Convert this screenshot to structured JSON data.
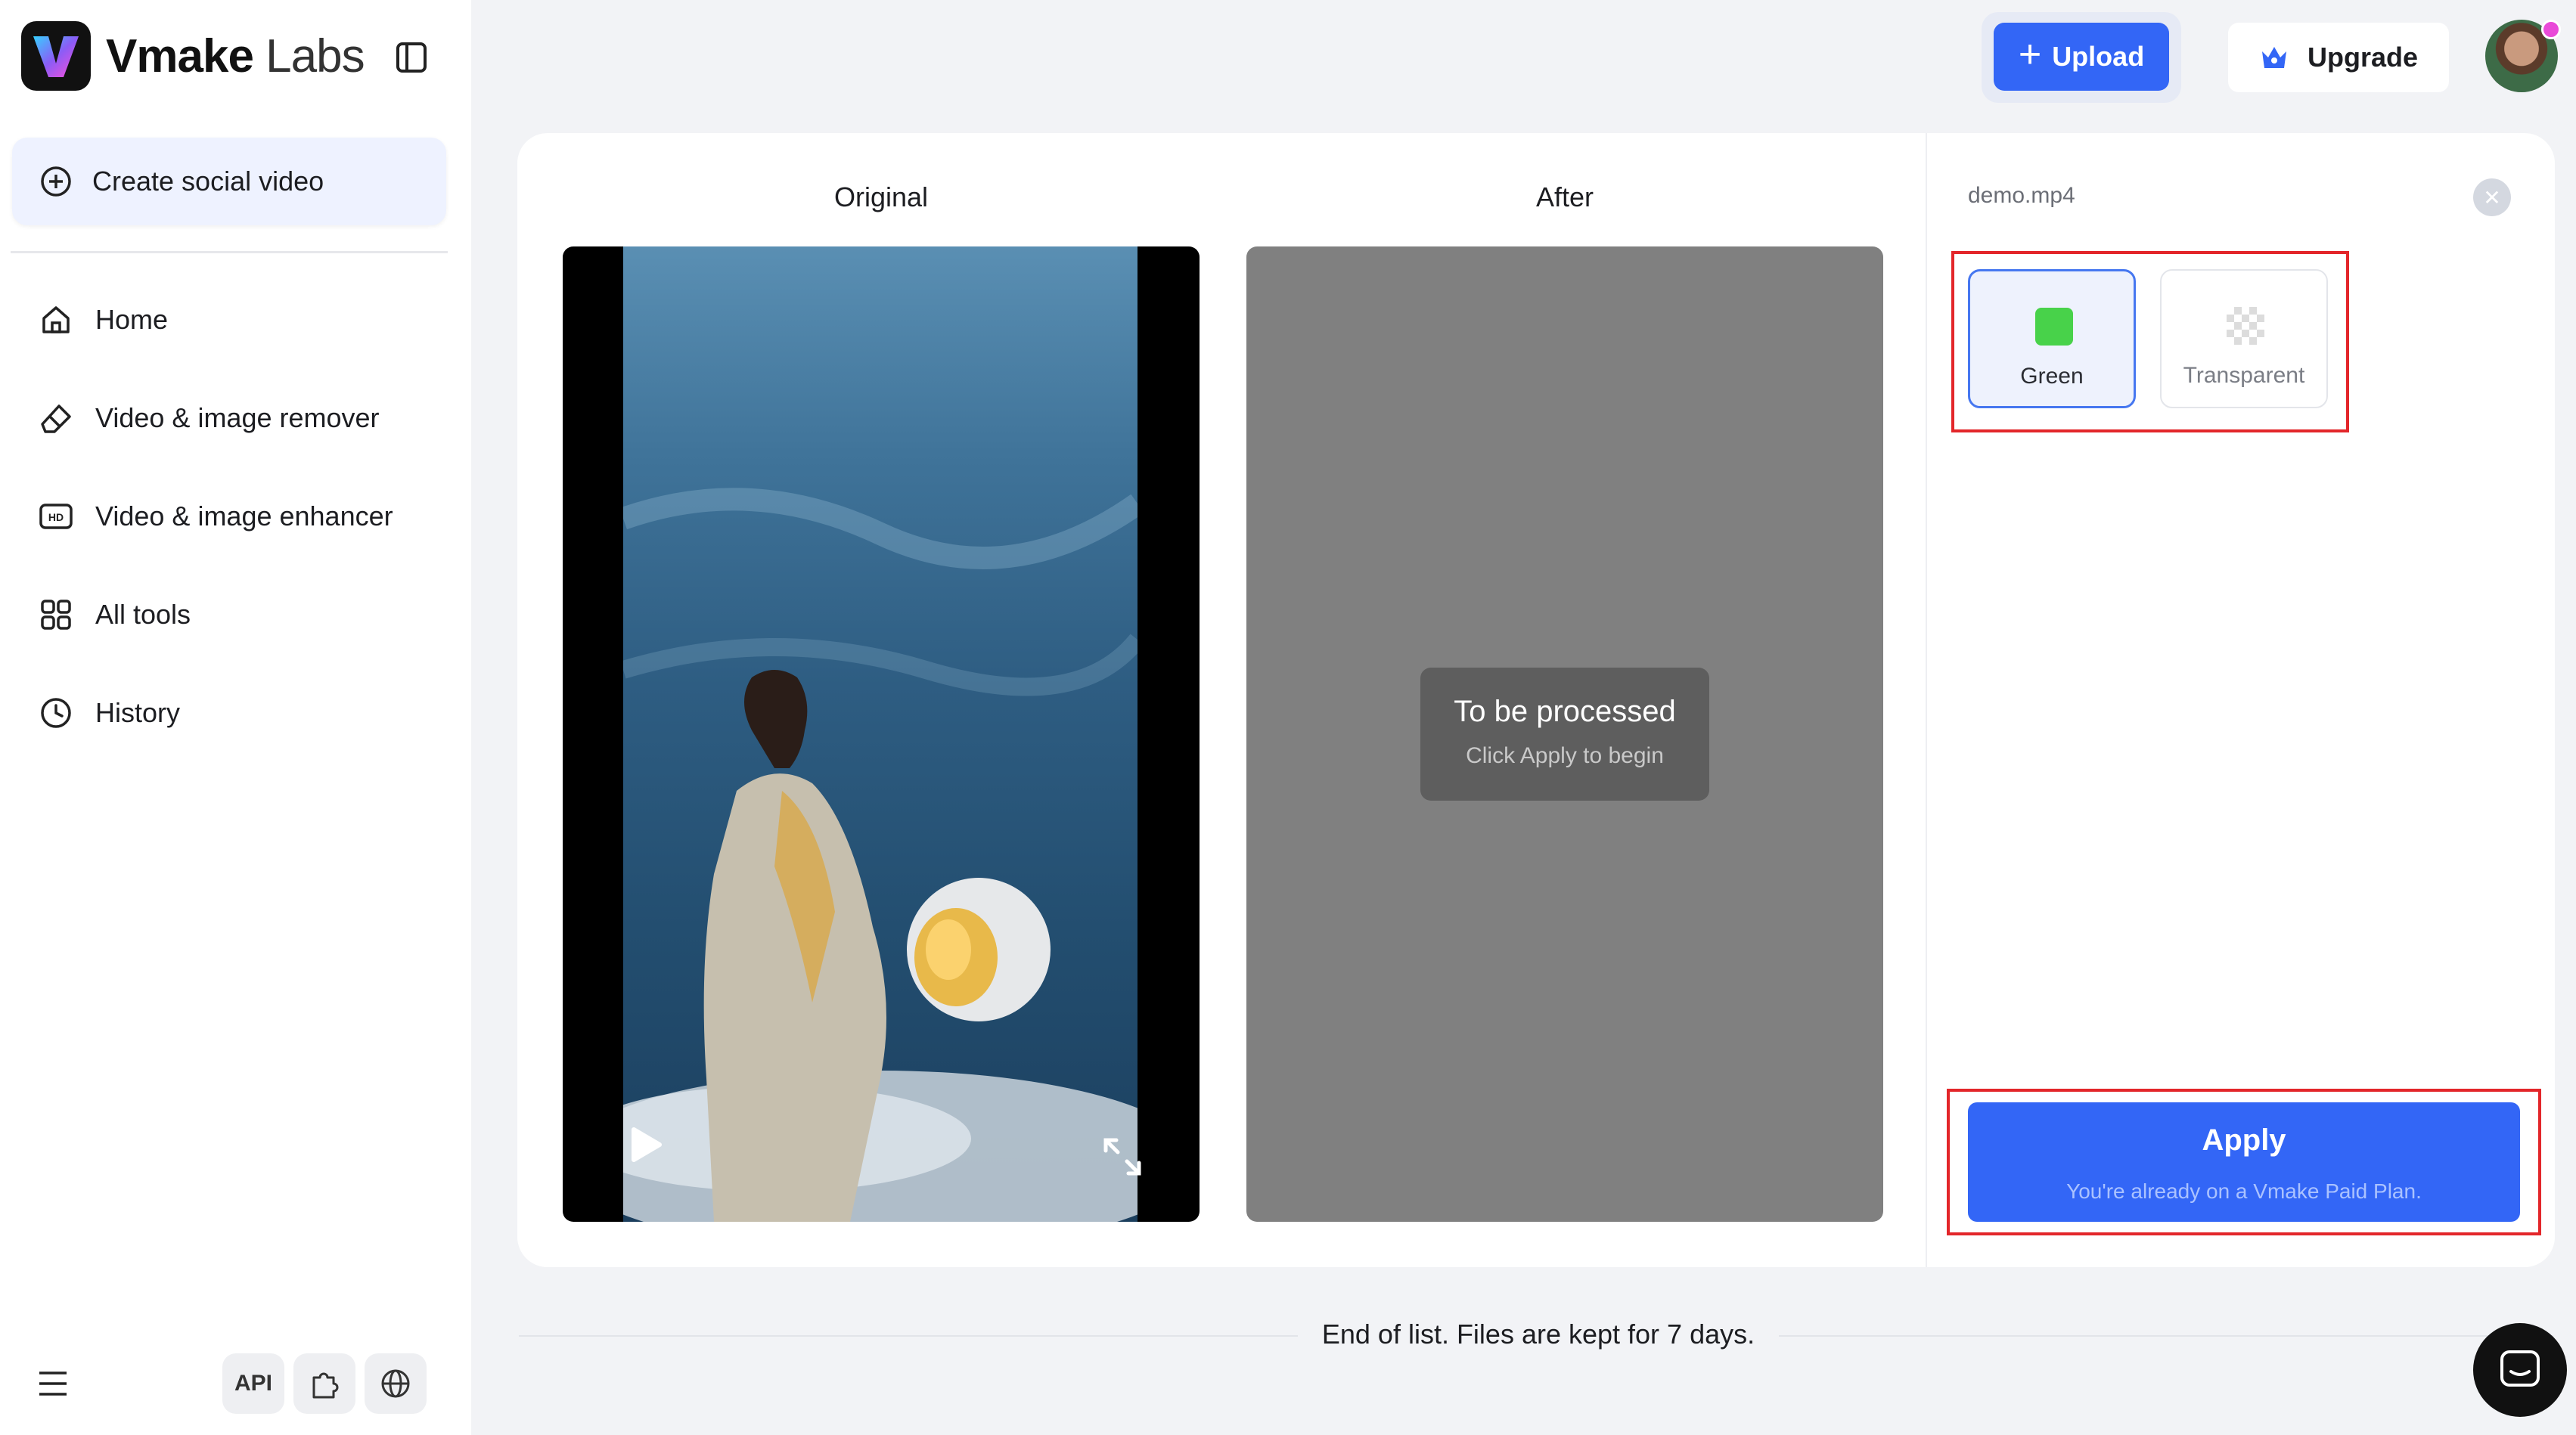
{
  "sidebar": {
    "brand": {
      "name": "Vmake",
      "suffix": "Labs"
    },
    "create_label": "Create social video",
    "items": [
      {
        "label": "Home",
        "icon": "home-icon"
      },
      {
        "label": "Video & image remover",
        "icon": "eraser-icon"
      },
      {
        "label": "Video & image enhancer",
        "icon": "hd-icon"
      },
      {
        "label": "All tools",
        "icon": "grid-icon"
      },
      {
        "label": "History",
        "icon": "clock-icon"
      }
    ],
    "bottom": {
      "api_label": "API"
    }
  },
  "header": {
    "upload_label": "Upload",
    "upgrade_label": "Upgrade"
  },
  "main": {
    "original_title": "Original",
    "after_title": "After",
    "status_title": "To be processed",
    "status_subtitle": "Click Apply to begin"
  },
  "panel": {
    "file_name": "demo.mp4",
    "options": [
      {
        "label": "Green",
        "color": "#48d24a",
        "selected": true
      },
      {
        "label": "Transparent",
        "selected": false
      }
    ],
    "apply_label": "Apply",
    "apply_note": "You're already on a Vmake Paid Plan."
  },
  "footer": {
    "end_text": "End of list. Files are kept for 7 days."
  },
  "colors": {
    "accent": "#3366f6",
    "highlight_box": "#e3262a",
    "page_bg": "#f2f3f6"
  }
}
